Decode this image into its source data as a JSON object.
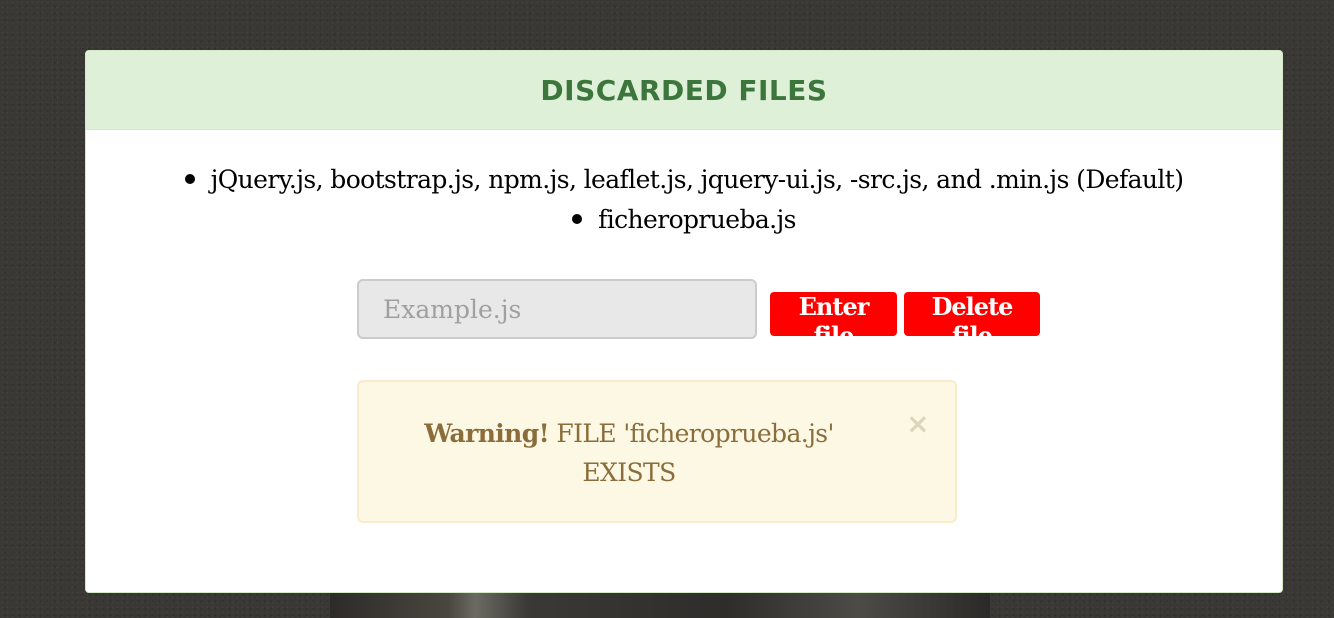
{
  "panel": {
    "title": "DISCARDED FILES"
  },
  "discarded_files": [
    "jQuery.js, bootstrap.js, npm.js, leaflet.js, jquery-ui.js, -src.js, and .min.js (Default)",
    "ficheroprueba.js"
  ],
  "form": {
    "input_placeholder": "Example.js",
    "input_value": "",
    "enter_label": "Enter file",
    "delete_label": "Delete file"
  },
  "alert": {
    "strong": "Warning!",
    "message": "FILE 'ficheroprueba.js' EXISTS",
    "close_symbol": "×"
  },
  "colors": {
    "panel_heading_bg": "#dff0d8",
    "panel_title": "#3c763d",
    "button_bg": "#ff0000",
    "alert_bg": "#fcf8e3",
    "alert_text": "#8a6d3b"
  }
}
